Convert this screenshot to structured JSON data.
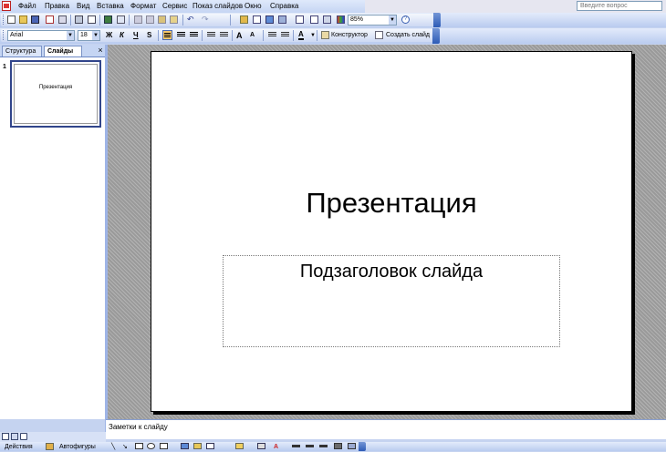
{
  "menu": {
    "items": [
      {
        "label": "Файл"
      },
      {
        "label": "Правка"
      },
      {
        "label": "Вид"
      },
      {
        "label": "Вставка"
      },
      {
        "label": "Формат"
      },
      {
        "label": "Сервис"
      },
      {
        "label": "Показ слайдов"
      },
      {
        "label": "Окно"
      },
      {
        "label": "Справка"
      }
    ],
    "help_placeholder": "Введите вопрос"
  },
  "standard_toolbar": {
    "zoom_value": "85%"
  },
  "format_toolbar": {
    "font_name": "Arial",
    "font_size": "18",
    "bold_label": "Ж",
    "italic_label": "К",
    "underline_label": "Ч",
    "shadow_label": "S",
    "font_color_label": "A",
    "designer_label": "Конструктор",
    "new_slide_label": "Создать слайд"
  },
  "left_pane": {
    "tabs": [
      {
        "label": "Структура",
        "active": false
      },
      {
        "label": "Слайды",
        "active": true
      }
    ],
    "close_glyph": "×",
    "slide_number": "1",
    "thumb_title": "Презентация"
  },
  "slide": {
    "title": "Презентация",
    "subtitle": "Подзаголовок слайда"
  },
  "notes": {
    "placeholder": "Заметки к слайду"
  },
  "drawing_toolbar": {
    "actions_label": "Действия",
    "autoshapes_label": "Автофигуры"
  },
  "colors": {
    "toolbar_blue": "#c5d5f3",
    "slide_border": "#000000",
    "thumb_border": "#31458b"
  }
}
